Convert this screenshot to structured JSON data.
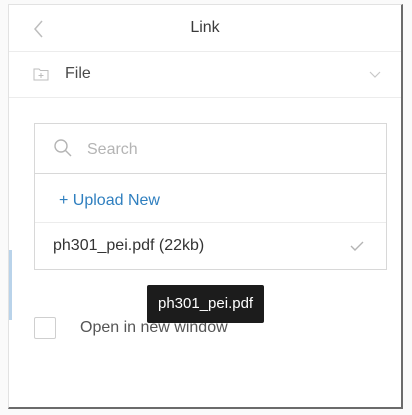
{
  "header": {
    "back_icon": "chevron-left-icon",
    "title": "Link"
  },
  "source_select": {
    "icon": "folder-icon",
    "label": "File",
    "chevron_icon": "chevron-down-icon"
  },
  "picker": {
    "search_icon": "search-icon",
    "search_value": "",
    "search_placeholder": "Search",
    "upload_label": "+ Upload New",
    "files": [
      {
        "name": "ph301_pei.pdf (22kb)",
        "selected": true,
        "check_icon": "check-icon"
      }
    ]
  },
  "options": {
    "open_new_window_label": "Open in new window",
    "open_new_window_checked": false
  },
  "tooltip": {
    "text": "ph301_pei.pdf"
  },
  "colors": {
    "accent_link": "#2f7fbf",
    "tooltip_bg": "#1c1c1c",
    "border": "#d8d8d8"
  }
}
